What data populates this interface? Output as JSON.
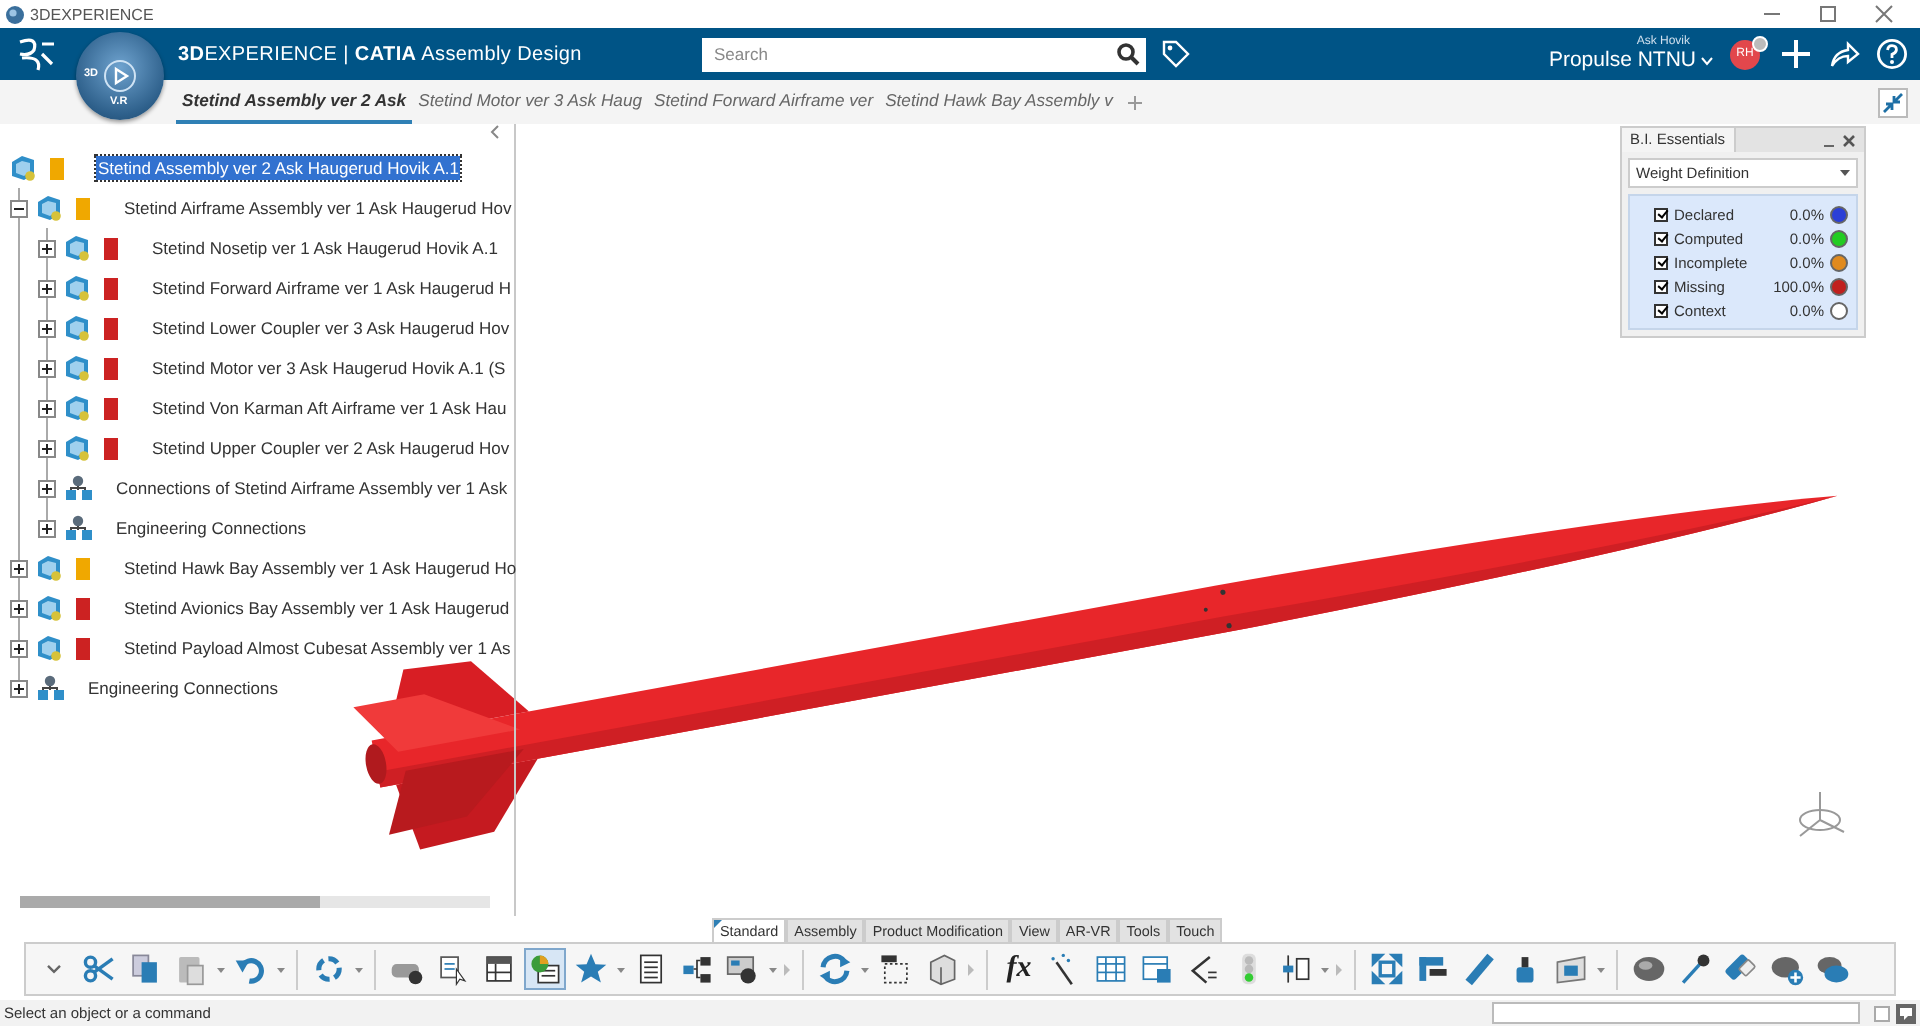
{
  "window": {
    "title": "3DEXPERIENCE"
  },
  "header": {
    "title": "**3D**EXPERIENCE | **CATIA** Assembly Design",
    "compass": {
      "left": "3D",
      "bottom": "V.R"
    },
    "search": {
      "placeholder": "Search"
    },
    "user": "Ask Hovik",
    "organization": "Propulse NTNU",
    "avatar": "RH"
  },
  "doc_tabs": [
    {
      "label": "Stetind Assembly ver 2 Ask",
      "selected": true
    },
    {
      "label": "Stetind Motor ver 3 Ask Haug",
      "selected": false
    },
    {
      "label": "Stetind Forward Airframe ver",
      "selected": false
    },
    {
      "label": "Stetind Hawk Bay Assembly v",
      "selected": false
    }
  ],
  "tree": [
    {
      "kind": "product",
      "label": "Stetind Assembly ver 2 Ask Haugerud Hovik A.1",
      "color": "#f0a800",
      "selected": true,
      "children": [
        {
          "kind": "product",
          "label": "Stetind Airframe Assembly ver 1 Ask Haugerud Hov",
          "color": "#f0a800",
          "expanded": true,
          "selected": false,
          "children": [
            {
              "kind": "product",
              "label": "Stetind Nosetip ver 1 Ask Haugerud Hovik A.1",
              "color": "#cc2222",
              "expanded": false,
              "selected": false
            },
            {
              "kind": "product",
              "label": "Stetind Forward Airframe ver 1 Ask Haugerud H",
              "color": "#cc2222",
              "expanded": false,
              "selected": false
            },
            {
              "kind": "product",
              "label": "Stetind Lower Coupler ver 3 Ask Haugerud Hov",
              "color": "#cc2222",
              "expanded": false,
              "selected": false
            },
            {
              "kind": "product",
              "label": "Stetind Motor ver 3 Ask Haugerud Hovik A.1 (S",
              "color": "#cc2222",
              "expanded": false,
              "selected": false
            },
            {
              "kind": "product",
              "label": "Stetind Von Karman Aft Airframe ver 1 Ask Hau",
              "color": "#cc2222",
              "expanded": false,
              "selected": false
            },
            {
              "kind": "product",
              "label": "Stetind Upper Coupler ver 2 Ask Haugerud Hov",
              "color": "#cc2222",
              "expanded": false,
              "selected": false
            },
            {
              "kind": "connections",
              "label": "Connections of Stetind Airframe Assembly ver 1 Ask",
              "expanded": false,
              "selected": false
            },
            {
              "kind": "connections",
              "label": "Engineering Connections",
              "expanded": false,
              "selected": false
            }
          ]
        },
        {
          "kind": "product",
          "label": "Stetind Hawk Bay Assembly ver 1 Ask Haugerud Ho",
          "color": "#f0a800",
          "expanded": false,
          "selected": false
        },
        {
          "kind": "product",
          "label": "Stetind Avionics Bay Assembly ver 1 Ask Haugerud",
          "color": "#cc2222",
          "expanded": false,
          "selected": false
        },
        {
          "kind": "product",
          "label": "Stetind Payload Almost Cubesat Assembly ver 1 As",
          "color": "#cc2222",
          "expanded": false,
          "selected": false
        },
        {
          "kind": "connections",
          "label": "Engineering Connections",
          "expanded": false,
          "selected": false
        }
      ]
    }
  ],
  "bi_panel": {
    "title": "B.I. Essentials",
    "mode": "Weight Definition",
    "legend": [
      {
        "label": "Declared",
        "value": "0.0%",
        "checked": true,
        "color": "#2b3fd6"
      },
      {
        "label": "Computed",
        "value": "0.0%",
        "checked": true,
        "color": "#22cc22"
      },
      {
        "label": "Incomplete",
        "value": "0.0%",
        "checked": true,
        "color": "#e08a1e"
      },
      {
        "label": "Missing",
        "value": "100.0%",
        "checked": true,
        "color": "#c0201e"
      },
      {
        "label": "Context",
        "value": "0.0%",
        "checked": true,
        "color": "#ffffff"
      }
    ]
  },
  "section_tabs": [
    {
      "label": "Standard",
      "selected": true
    },
    {
      "label": "Assembly",
      "selected": false
    },
    {
      "label": "Product Modification",
      "selected": false
    },
    {
      "label": "View",
      "selected": false
    },
    {
      "label": "AR-VR",
      "selected": false
    },
    {
      "label": "Tools",
      "selected": false
    },
    {
      "label": "Touch",
      "selected": false
    }
  ],
  "toolbar": {
    "formula_label": "fx",
    "tools": [
      {
        "pressed": false
      },
      {
        "pressed": false
      },
      {
        "pressed": false
      },
      {
        "pressed": false
      },
      {
        "pressed": false
      },
      {
        "pressed": false
      },
      {
        "pressed": false
      },
      {
        "pressed": false
      },
      {
        "pressed": false
      },
      {
        "pressed": true
      },
      {
        "pressed": false
      },
      {
        "pressed": false
      },
      {
        "pressed": false
      },
      {
        "pressed": false
      },
      {
        "pressed": false
      },
      {
        "pressed": false
      },
      {
        "pressed": false
      },
      {
        "pressed": false
      },
      {
        "pressed": false
      },
      {
        "pressed": false
      },
      {
        "pressed": false
      },
      {
        "pressed": false
      },
      {
        "pressed": false
      },
      {
        "pressed": false
      },
      {
        "pressed": false
      },
      {
        "pressed": false
      },
      {
        "pressed": false
      },
      {
        "pressed": false
      },
      {
        "pressed": false
      },
      {
        "pressed": false
      },
      {
        "pressed": false
      },
      {
        "pressed": false
      },
      {
        "pressed": false
      },
      {
        "pressed": false
      }
    ]
  },
  "status_bar": {
    "message": "Select an object or a command"
  }
}
